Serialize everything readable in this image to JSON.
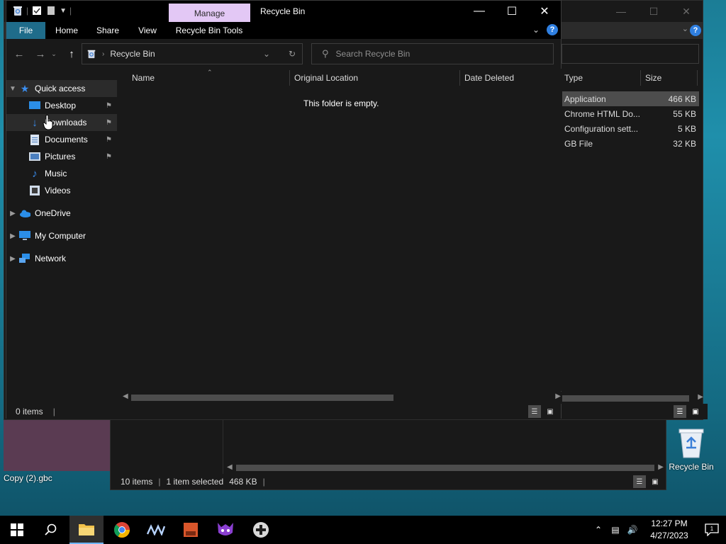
{
  "front_window": {
    "title": "Recycle Bin",
    "manage_tab": "Manage",
    "ribbon_tabs": [
      "File",
      "Home",
      "Share",
      "View",
      "Recycle Bin Tools"
    ],
    "address": "Recycle Bin",
    "search_placeholder": "Search Recycle Bin",
    "sidebar": {
      "quick_access": "Quick access",
      "items": [
        "Desktop",
        "Downloads",
        "Documents",
        "Pictures",
        "Music",
        "Videos"
      ],
      "onedrive": "OneDrive",
      "my_computer": "My Computer",
      "network": "Network"
    },
    "columns": [
      "Name",
      "Original Location",
      "Date Deleted"
    ],
    "empty_message": "This folder is empty.",
    "status": "0 items"
  },
  "rear_window": {
    "columns": [
      "Type",
      "Size"
    ],
    "rows": [
      {
        "type": "Application",
        "size": "466 KB"
      },
      {
        "type": "Chrome HTML Do...",
        "size": "55 KB"
      },
      {
        "type": "Configuration sett...",
        "size": "5 KB"
      },
      {
        "type": "GB File",
        "size": "32 KB"
      }
    ]
  },
  "bottom_window": {
    "items_count": "10 items",
    "selection": "1 item selected",
    "selection_size": "468 KB"
  },
  "desktop": {
    "file_label": "Copy (2).gbc",
    "recycle_bin_label": "Recycle Bin"
  },
  "taskbar": {
    "time": "12:27 PM",
    "date": "4/27/2023"
  },
  "colors": {
    "manage_tab": "#e3c8f5",
    "file_tab": "#1f6c8a",
    "selection": "#4d4d4d",
    "taskbar_accent": "#6fb6ff"
  }
}
